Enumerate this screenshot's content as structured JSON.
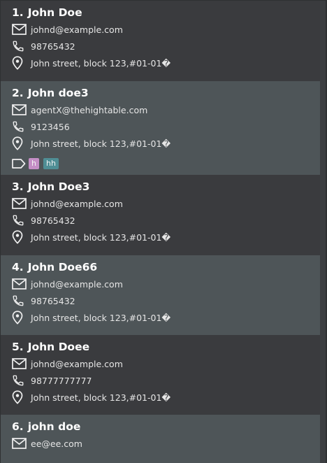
{
  "persons": [
    {
      "index": "1.",
      "name": "John Doe",
      "email": "johnd@example.com",
      "phone": "98765432",
      "address": "John street, block 123,#01-01�",
      "tags": []
    },
    {
      "index": "2.",
      "name": "John doe3",
      "email": "agentX@thehightable.com",
      "phone": "9123456",
      "address": "John street, block 123,#01-01�",
      "tags": [
        {
          "label": "h",
          "color": "#c58fc6"
        },
        {
          "label": "hh",
          "color": "#4f8e95"
        }
      ]
    },
    {
      "index": "3.",
      "name": "John Doe3",
      "email": "johnd@example.com",
      "phone": "98765432",
      "address": "John street, block 123,#01-01�",
      "tags": []
    },
    {
      "index": "4.",
      "name": "John Doe66",
      "email": "johnd@example.com",
      "phone": "98765432",
      "address": "John street, block 123,#01-01�",
      "tags": []
    },
    {
      "index": "5.",
      "name": "John Doee",
      "email": "johnd@example.com",
      "phone": "98777777777",
      "address": "John street, block 123,#01-01�",
      "tags": []
    },
    {
      "index": "6.",
      "name": "john doe",
      "email": "ee@ee.com",
      "phone": "",
      "address": "",
      "tags": []
    }
  ],
  "icons": {
    "email": "envelope-icon",
    "phone": "phone-icon",
    "address": "location-pin-icon",
    "tags": "tag-icon"
  }
}
